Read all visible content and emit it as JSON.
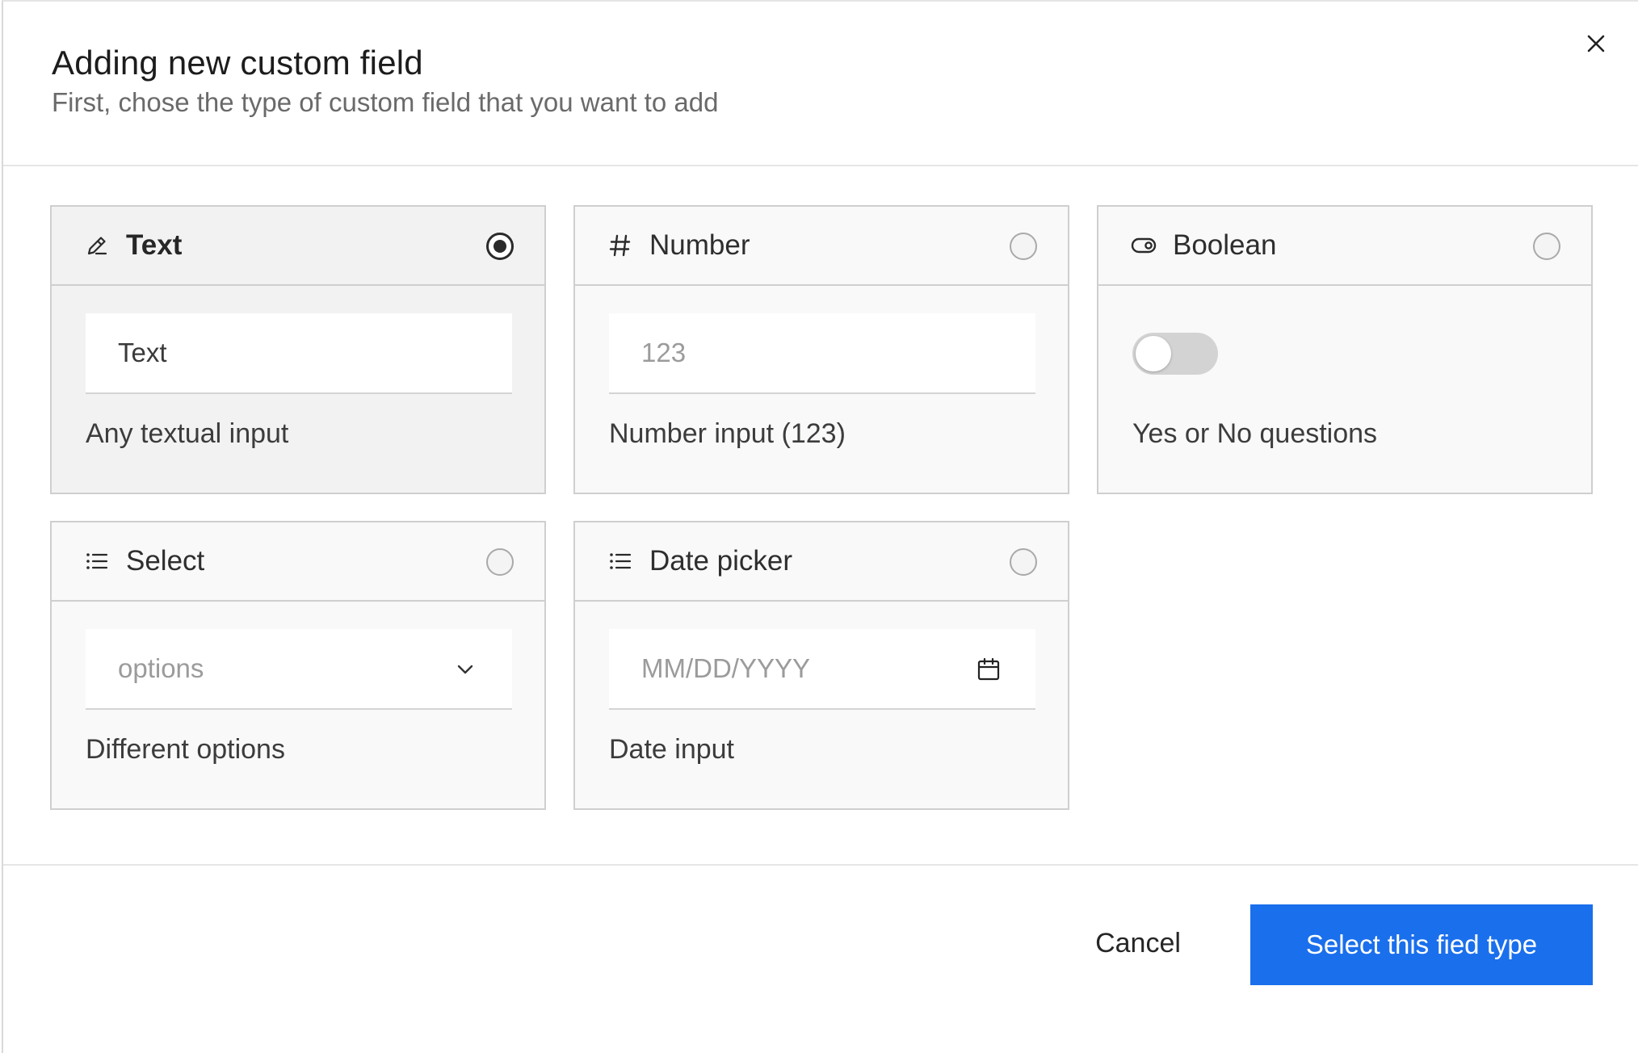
{
  "dialog": {
    "title": "Adding new custom field",
    "subtitle": "First, chose the type of custom field that you want to add",
    "close_icon": "close-icon"
  },
  "field_types": [
    {
      "label": "Text",
      "icon": "pencil-icon",
      "selected": true,
      "preview_value": "Text",
      "description": "Any textual input"
    },
    {
      "label": "Number",
      "icon": "hash-icon",
      "selected": false,
      "preview_placeholder": "123",
      "description": "Number input (123)"
    },
    {
      "label": "Boolean",
      "icon": "toggle-icon",
      "selected": false,
      "preview_toggle_on": false,
      "description": "Yes or No questions"
    },
    {
      "label": "Select",
      "icon": "list-icon",
      "selected": false,
      "preview_placeholder": "options",
      "description": "Different options"
    },
    {
      "label": "Date picker",
      "icon": "list-icon",
      "selected": false,
      "preview_placeholder": "MM/DD/YYYY",
      "description": "Date input"
    }
  ],
  "footer": {
    "cancel_label": "Cancel",
    "submit_label": "Select this fied type"
  },
  "colors": {
    "primary": "#1a6fec",
    "card_bg": "#f8f9f8",
    "border": "#cfcfcf"
  }
}
